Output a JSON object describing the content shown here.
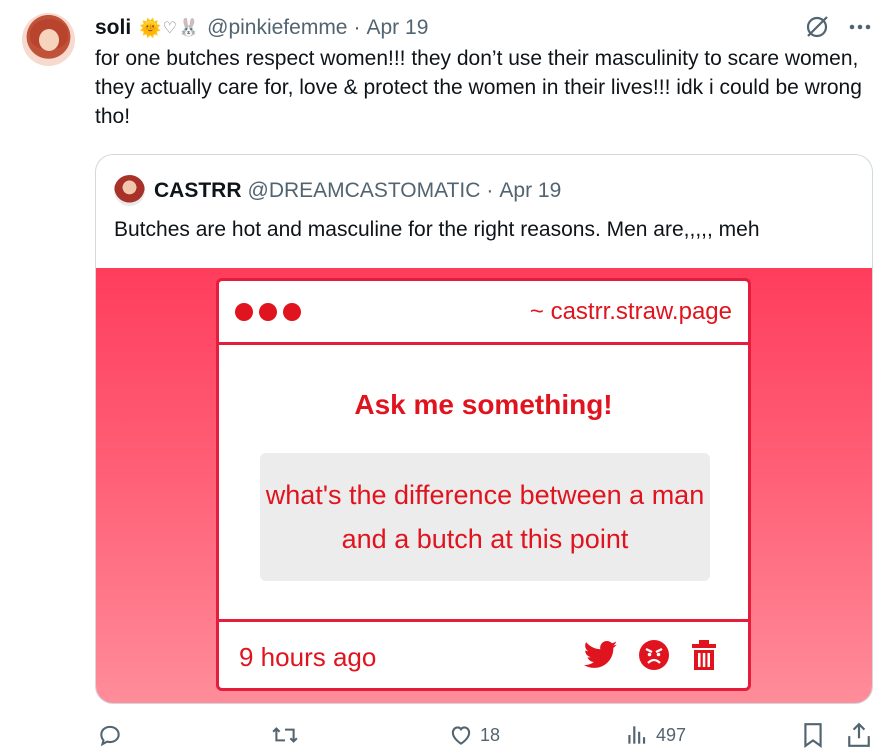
{
  "tweet": {
    "author_name": "soli",
    "author_emojis": [
      "🌞",
      "♡",
      "🐰"
    ],
    "handle": "@pinkiefemme",
    "separator": "·",
    "date": "Apr 19",
    "text": "for one butches respect women!!! they don’t use their masculinity to scare women, they actually care for, love & protect the women in their lives!!! idk i could be wrong tho!"
  },
  "top_actions": {
    "icons": [
      "grok-icon",
      "more-icon"
    ],
    "more_label": "···"
  },
  "quote": {
    "author_name": "CASTRR",
    "handle": "@DREAMCASTOMATIC",
    "separator": "·",
    "date": "Apr 19",
    "text": "Butches are hot and masculine for the right reasons. Men are,,,,, meh",
    "image": {
      "url_label": "~ castrr.straw.page",
      "heading": "Ask me something!",
      "question": "what's the difference between a man and a butch at this point",
      "time": "9 hours ago",
      "accent_color": "#e0141e",
      "icons": [
        "twitter-bird-icon",
        "angry-face-icon",
        "trash-icon"
      ]
    }
  },
  "actions": {
    "reply_count": "",
    "retweet_count": "",
    "like_count": "18",
    "views_count": "497"
  },
  "colors": {
    "text": "#0f1419",
    "secondary": "#536471",
    "border": "#cfd9de"
  }
}
